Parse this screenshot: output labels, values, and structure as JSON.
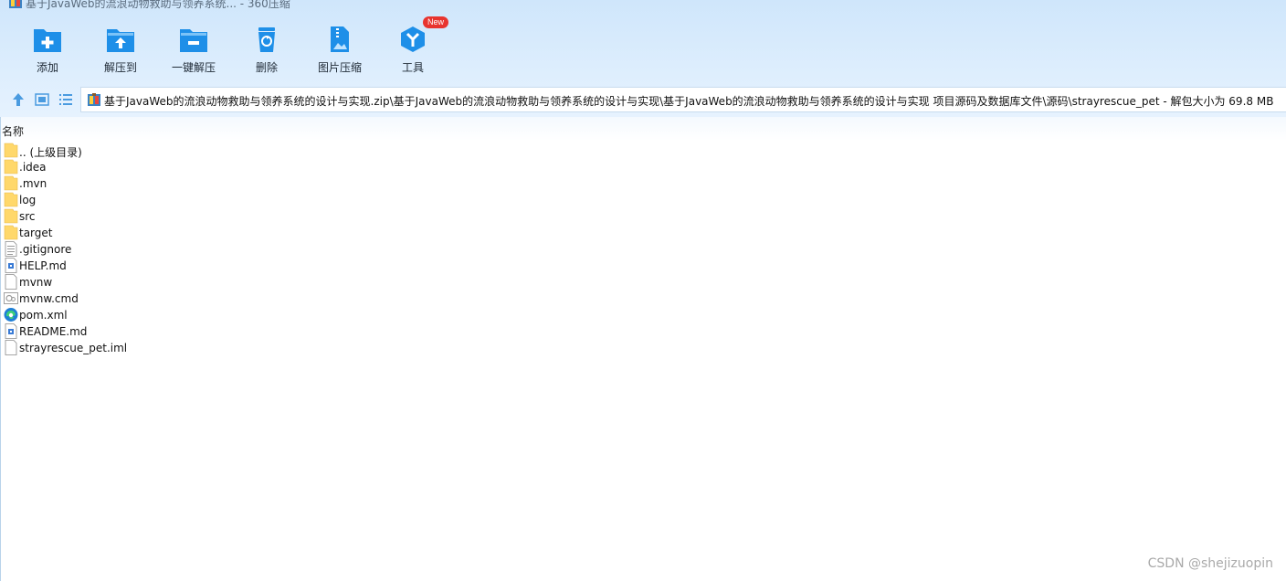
{
  "window": {
    "title": "基于JavaWeb的流浪动物救助与领养系统... - 360压缩",
    "app_icon": "archive-icon"
  },
  "toolbar": {
    "buttons": [
      {
        "label": "添加",
        "icon": "add-folder-icon"
      },
      {
        "label": "解压到",
        "icon": "extract-to-icon"
      },
      {
        "label": "一键解压",
        "icon": "one-click-extract-icon"
      },
      {
        "label": "删除",
        "icon": "recycle-bin-icon"
      },
      {
        "label": "图片压缩",
        "icon": "image-compress-icon"
      },
      {
        "label": "工具",
        "icon": "tools-icon",
        "badge": "New"
      }
    ]
  },
  "nav": {
    "up_icon": "arrow-up-icon",
    "thumb_icon": "thumbnail-view-icon",
    "list_icon": "list-view-icon",
    "path": "基于JavaWeb的流浪动物救助与领养系统的设计与实现.zip\\基于JavaWeb的流浪动物救助与领养系统的设计与实现\\基于JavaWeb的流浪动物救助与领养系统的设计与实现 项目源码及数据库文件\\源码\\strayrescue_pet - 解包大小为 69.8 MB"
  },
  "list": {
    "column_name": "名称",
    "files": [
      {
        "name": ".. (上级目录)",
        "type": "folder"
      },
      {
        "name": ".idea",
        "type": "folder"
      },
      {
        "name": ".mvn",
        "type": "folder"
      },
      {
        "name": "log",
        "type": "folder"
      },
      {
        "name": "src",
        "type": "folder"
      },
      {
        "name": "target",
        "type": "folder"
      },
      {
        "name": ".gitignore",
        "type": "text"
      },
      {
        "name": "HELP.md",
        "type": "md"
      },
      {
        "name": "mvnw",
        "type": "blank"
      },
      {
        "name": "mvnw.cmd",
        "type": "cmd"
      },
      {
        "name": "pom.xml",
        "type": "edge"
      },
      {
        "name": "README.md",
        "type": "md"
      },
      {
        "name": "strayrescue_pet.iml",
        "type": "blank"
      }
    ]
  },
  "watermark": "CSDN @shejizuopin",
  "colors": {
    "accent": "#1e8fe8",
    "folder": "#ffd86b",
    "badge": "#e8342f"
  }
}
